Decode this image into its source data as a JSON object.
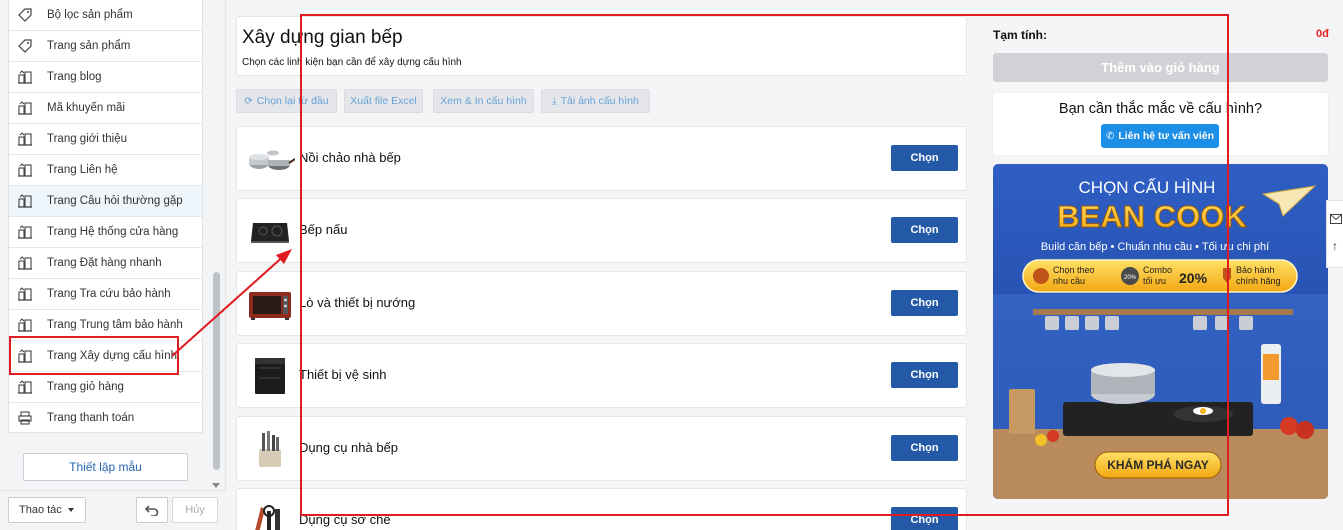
{
  "sidebar": {
    "items": [
      {
        "label": "Bộ lọc sản phẩm",
        "icon": "tag-icon"
      },
      {
        "label": "Trang sản phẩm",
        "icon": "tag-icon"
      },
      {
        "label": "Trang blog",
        "icon": "building-icon"
      },
      {
        "label": "Mã khuyến mãi",
        "icon": "building-icon"
      },
      {
        "label": "Trang giới thiệu",
        "icon": "building-icon"
      },
      {
        "label": "Trang Liên hệ",
        "icon": "building-icon"
      },
      {
        "label": "Trang Câu hỏi thường gặp",
        "icon": "building-icon"
      },
      {
        "label": "Trang Hệ thống cửa hàng",
        "icon": "building-icon"
      },
      {
        "label": "Trang Đặt hàng nhanh",
        "icon": "building-icon"
      },
      {
        "label": "Trang Tra cứu bảo hành",
        "icon": "building-icon"
      },
      {
        "label": "Trang Trung tâm bảo hành",
        "icon": "building-icon"
      },
      {
        "label": "Trang Xây dựng cấu hình",
        "icon": "building-icon"
      },
      {
        "label": "Trang giỏ hàng",
        "icon": "building-icon"
      },
      {
        "label": "Trang thanh toán",
        "icon": "printer-icon"
      }
    ],
    "template_button": "Thiết lập mẫu",
    "action_select": "Thao tác",
    "cancel_button": "Hủy"
  },
  "builder": {
    "title": "Xây dựng gian bếp",
    "subtitle": "Chọn các linh kiện bạn cần để xây dựng cấu hình",
    "toolbar": {
      "reset": "Chọn lại từ đầu",
      "export_excel": "Xuất file Excel",
      "preview_print": "Xem & In cấu hình",
      "download_image": "Tải ảnh cấu hình"
    },
    "categories": [
      {
        "name": "Nồi chảo nhà bếp",
        "button": "Chọn"
      },
      {
        "name": "Bếp nấu",
        "button": "Chọn"
      },
      {
        "name": "Lò và thiết bị nướng",
        "button": "Chọn"
      },
      {
        "name": "Thiết bị vệ sinh",
        "button": "Chọn"
      },
      {
        "name": "Dụng cụ nhà bếp",
        "button": "Chọn"
      },
      {
        "name": "Dụng cụ sơ chế",
        "button": "Chọn"
      }
    ]
  },
  "summary": {
    "subtotal_label": "Tạm tính:",
    "subtotal_value": "0đ",
    "add_to_cart": "Thêm vào giỏ hàng",
    "help_question": "Bạn cần thắc mắc về cấu hình?",
    "contact_button": "Liên hệ tư vấn viên"
  },
  "banner": {
    "heading": "CHỌN CẤU HÌNH",
    "brand": "BEAN COOK",
    "tagline": "Build căn bếp • Chuẩn nhu cầu • Tối ưu chi phí",
    "feature_1a": "Chọn theo",
    "feature_1b": "nhu cầu",
    "badge": "20%",
    "feature_2a": "Combo",
    "feature_2b": "tối ưu",
    "percent": "20%",
    "feature_3a": "Bảo hành",
    "feature_3b": "chính hãng",
    "cta": "KHÁM PHÁ NGAY"
  },
  "colors": {
    "primary_button": "#2459a8",
    "annotation": "#e01b22",
    "banner_blue": "#2a56b8",
    "banner_gold": "#f6c21c"
  }
}
